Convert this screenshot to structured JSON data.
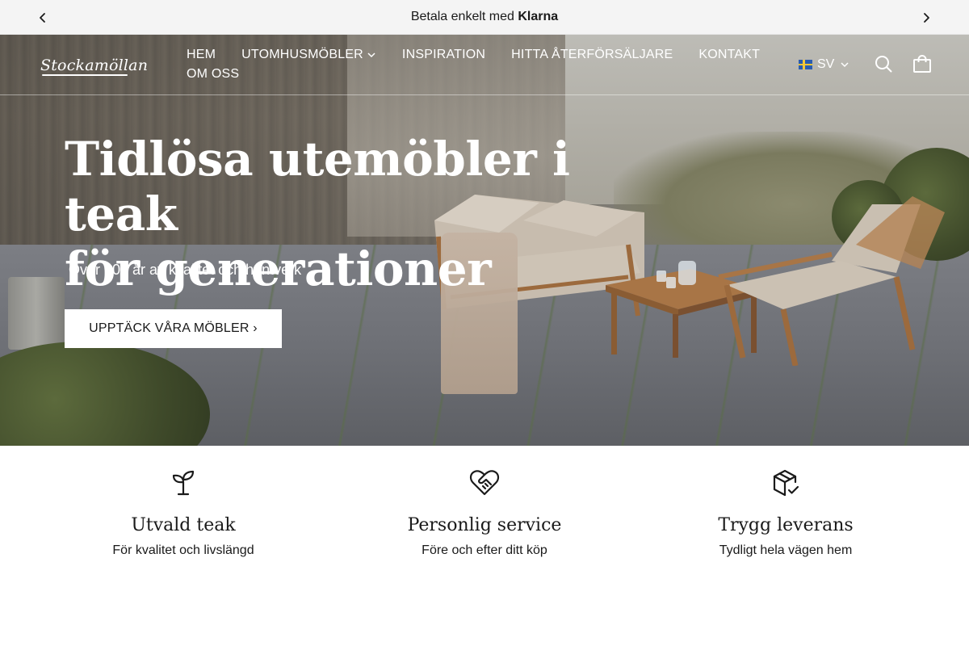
{
  "announcement": {
    "text_prefix": "Betala enkelt med",
    "text_bold": "Klarna",
    "prev_icon": "chevron-left-icon",
    "next_icon": "chevron-right-icon"
  },
  "header": {
    "logo_text": "Stockamöllan",
    "nav": [
      {
        "label": "HEM"
      },
      {
        "label": "UTOMHUSMÖBLER",
        "has_dropdown": true
      },
      {
        "label": "INSPIRATION"
      },
      {
        "label": "HITTA ÅTERFÖRSÄLJARE"
      },
      {
        "label": "KONTAKT"
      },
      {
        "label": "OM OSS"
      }
    ],
    "language": {
      "code": "SV",
      "flag": "swedish-flag-icon"
    },
    "search_icon": "search-icon",
    "cart_icon": "shopping-bag-icon"
  },
  "hero": {
    "title_line1": "Tidlösa utemöbler i teak",
    "title_line2": "för generationer",
    "subtitle": "Över 100 år av kvalitet och hantverk",
    "cta_label": "UPPTÄCK VÅRA MÖBLER ›"
  },
  "features": [
    {
      "icon": "sprout-icon",
      "title": "Utvald teak",
      "desc": "För kvalitet och livslängd"
    },
    {
      "icon": "heart-handshake-icon",
      "title": "Personlig service",
      "desc": "Före och efter ditt köp"
    },
    {
      "icon": "package-check-icon",
      "title": "Trygg leverans",
      "desc": "Tydligt hela vägen hem"
    }
  ],
  "colors": {
    "announce_bg": "#f4f4f4",
    "text": "#1a1a1a",
    "button_bg": "#ffffff"
  }
}
